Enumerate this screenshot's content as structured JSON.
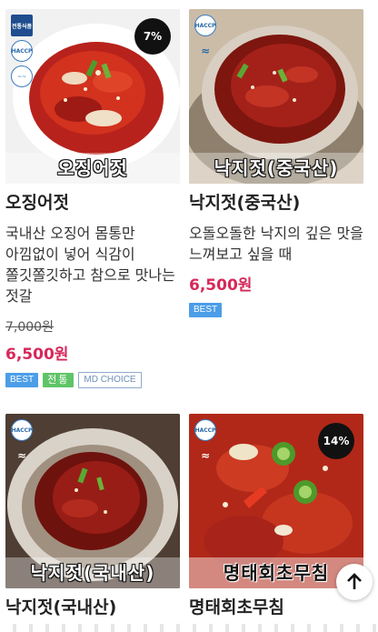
{
  "products": [
    {
      "name": "오징어젓",
      "image_label": "오징어젓",
      "discount": "7%",
      "description": "국내산 오징어 몸통만 아낌없이 넣어 식감이 쫄깃쫄깃하고 참으로 맛나는 젓갈",
      "original_price": "7,000원",
      "sale_price": "6,500원",
      "tags": [
        "BEST",
        "전통",
        "MD CHOICE"
      ]
    },
    {
      "name": "낙지젓(중국산)",
      "image_label": "낙지젓(중국산)",
      "description": "오돌오돌한 낙지의 깊은 맛을 느껴보고 싶을 때",
      "sale_price": "6,500원",
      "tags": [
        "BEST"
      ]
    },
    {
      "name": "낙지젓(국내산)",
      "image_label": "낙지젓(국내산)"
    },
    {
      "name": "명태회초무침",
      "image_label": "명태회초무침",
      "discount": "14%"
    }
  ],
  "cert_labels": {
    "top": "전통식품",
    "haccp": "HACCP"
  },
  "icons": {
    "scroll_top": "arrow-up-icon",
    "certification": "haccp-icon"
  },
  "colors": {
    "price": "#d6285a",
    "best_tag": "#4c9ee8",
    "jeontong_tag": "#5fc468",
    "md_tag_text": "#6c8fb9"
  }
}
